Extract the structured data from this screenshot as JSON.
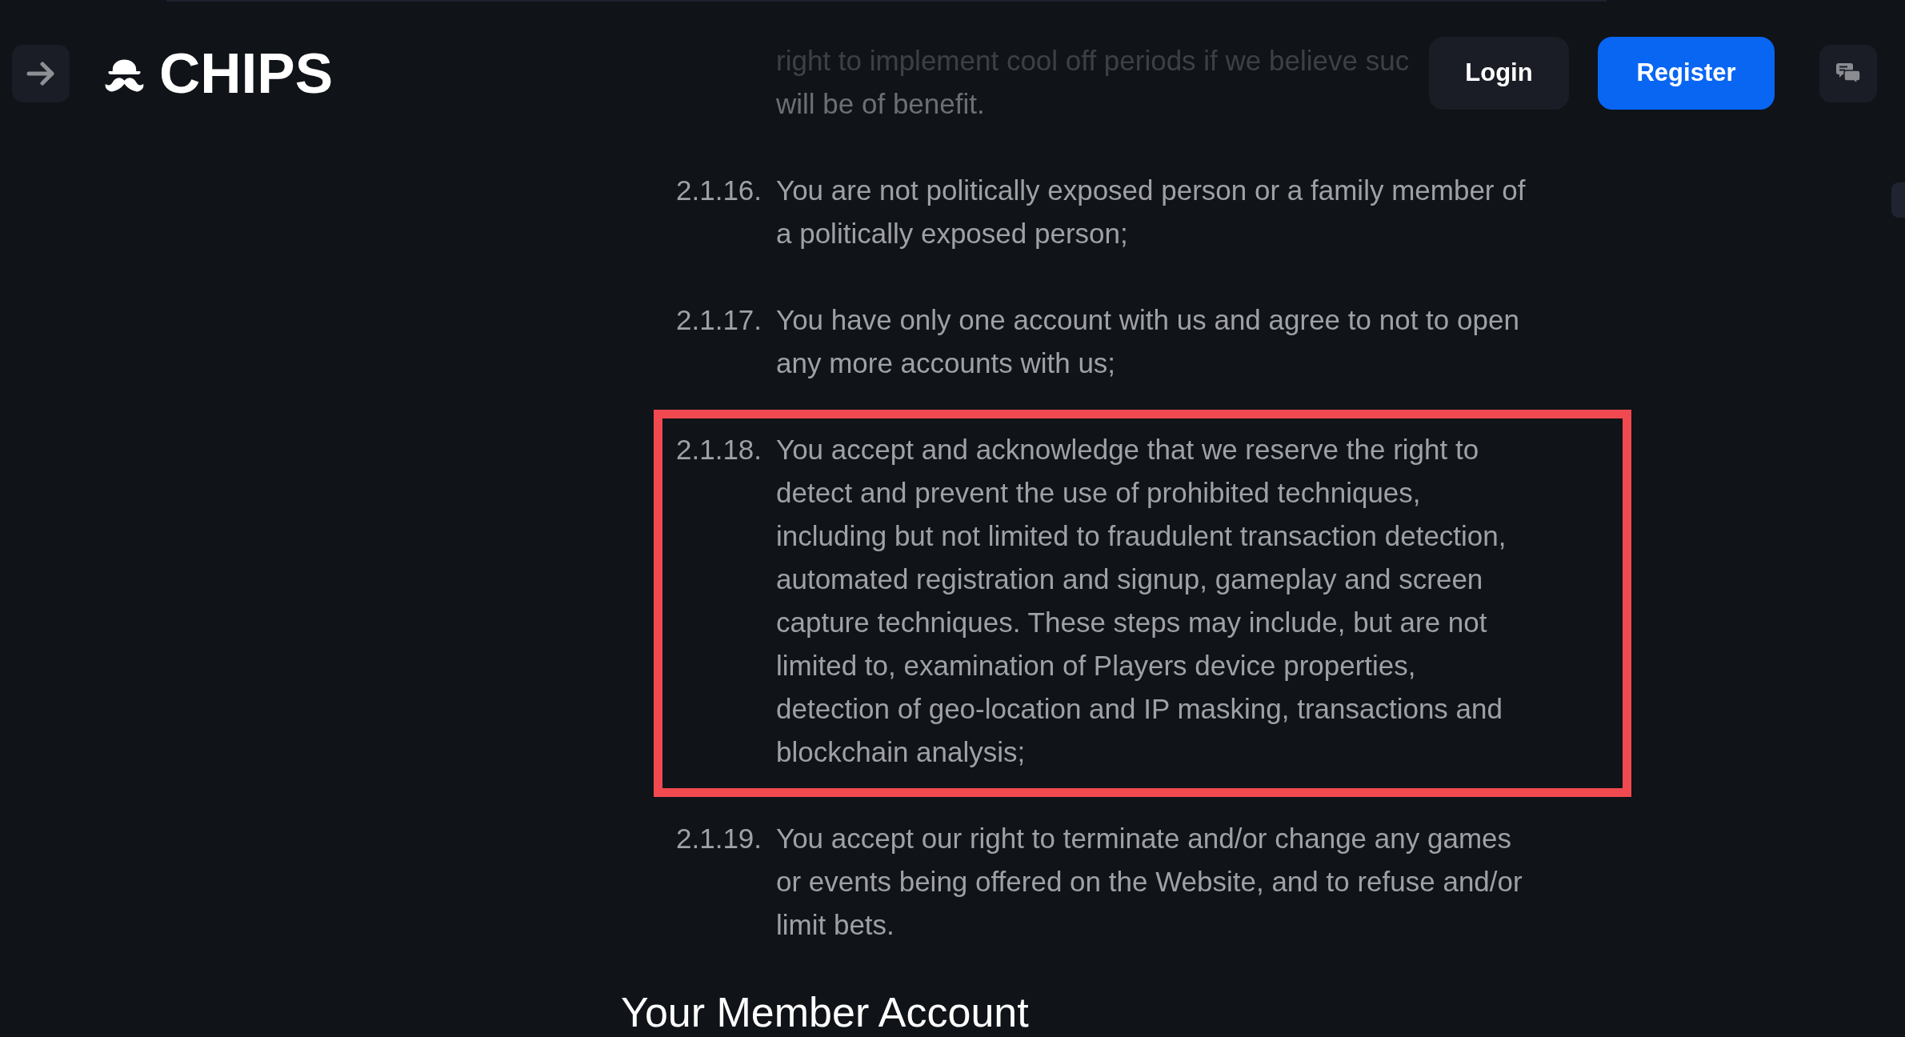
{
  "header": {
    "logo_text": "CHIPS",
    "buttons": [
      {
        "label": "Login",
        "kind": "secondary"
      },
      {
        "label": "Register",
        "kind": "primary"
      }
    ]
  },
  "terms": {
    "partial_item": {
      "lines": [
        "right to implement cool off periods if we believe suc",
        "will be of benefit."
      ]
    },
    "items": [
      {
        "number": "2.1.16.",
        "text": "You are not politically exposed person or a family member of a politically exposed person;",
        "highlighted": false
      },
      {
        "number": "2.1.17.",
        "text": "You have only one account with us and agree to not to open any more accounts with us;",
        "highlighted": false
      },
      {
        "number": "2.1.18.",
        "text": "You accept and acknowledge that we reserve the right to detect and prevent the use of prohibited techniques, including but not limited to fraudulent transaction detection, automated registration and signup, gameplay and screen capture techniques. These steps may include, but are not limited to, examination of Players device properties, detection of geo-location and IP masking, transactions and blockchain analysis;",
        "highlighted": true
      },
      {
        "number": "2.1.19.",
        "text": "You accept our right to terminate and/or change any games or events being offered on the Website, and to refuse and/or limit bets.",
        "highlighted": false
      }
    ]
  },
  "section_heading": "Your Member Account"
}
